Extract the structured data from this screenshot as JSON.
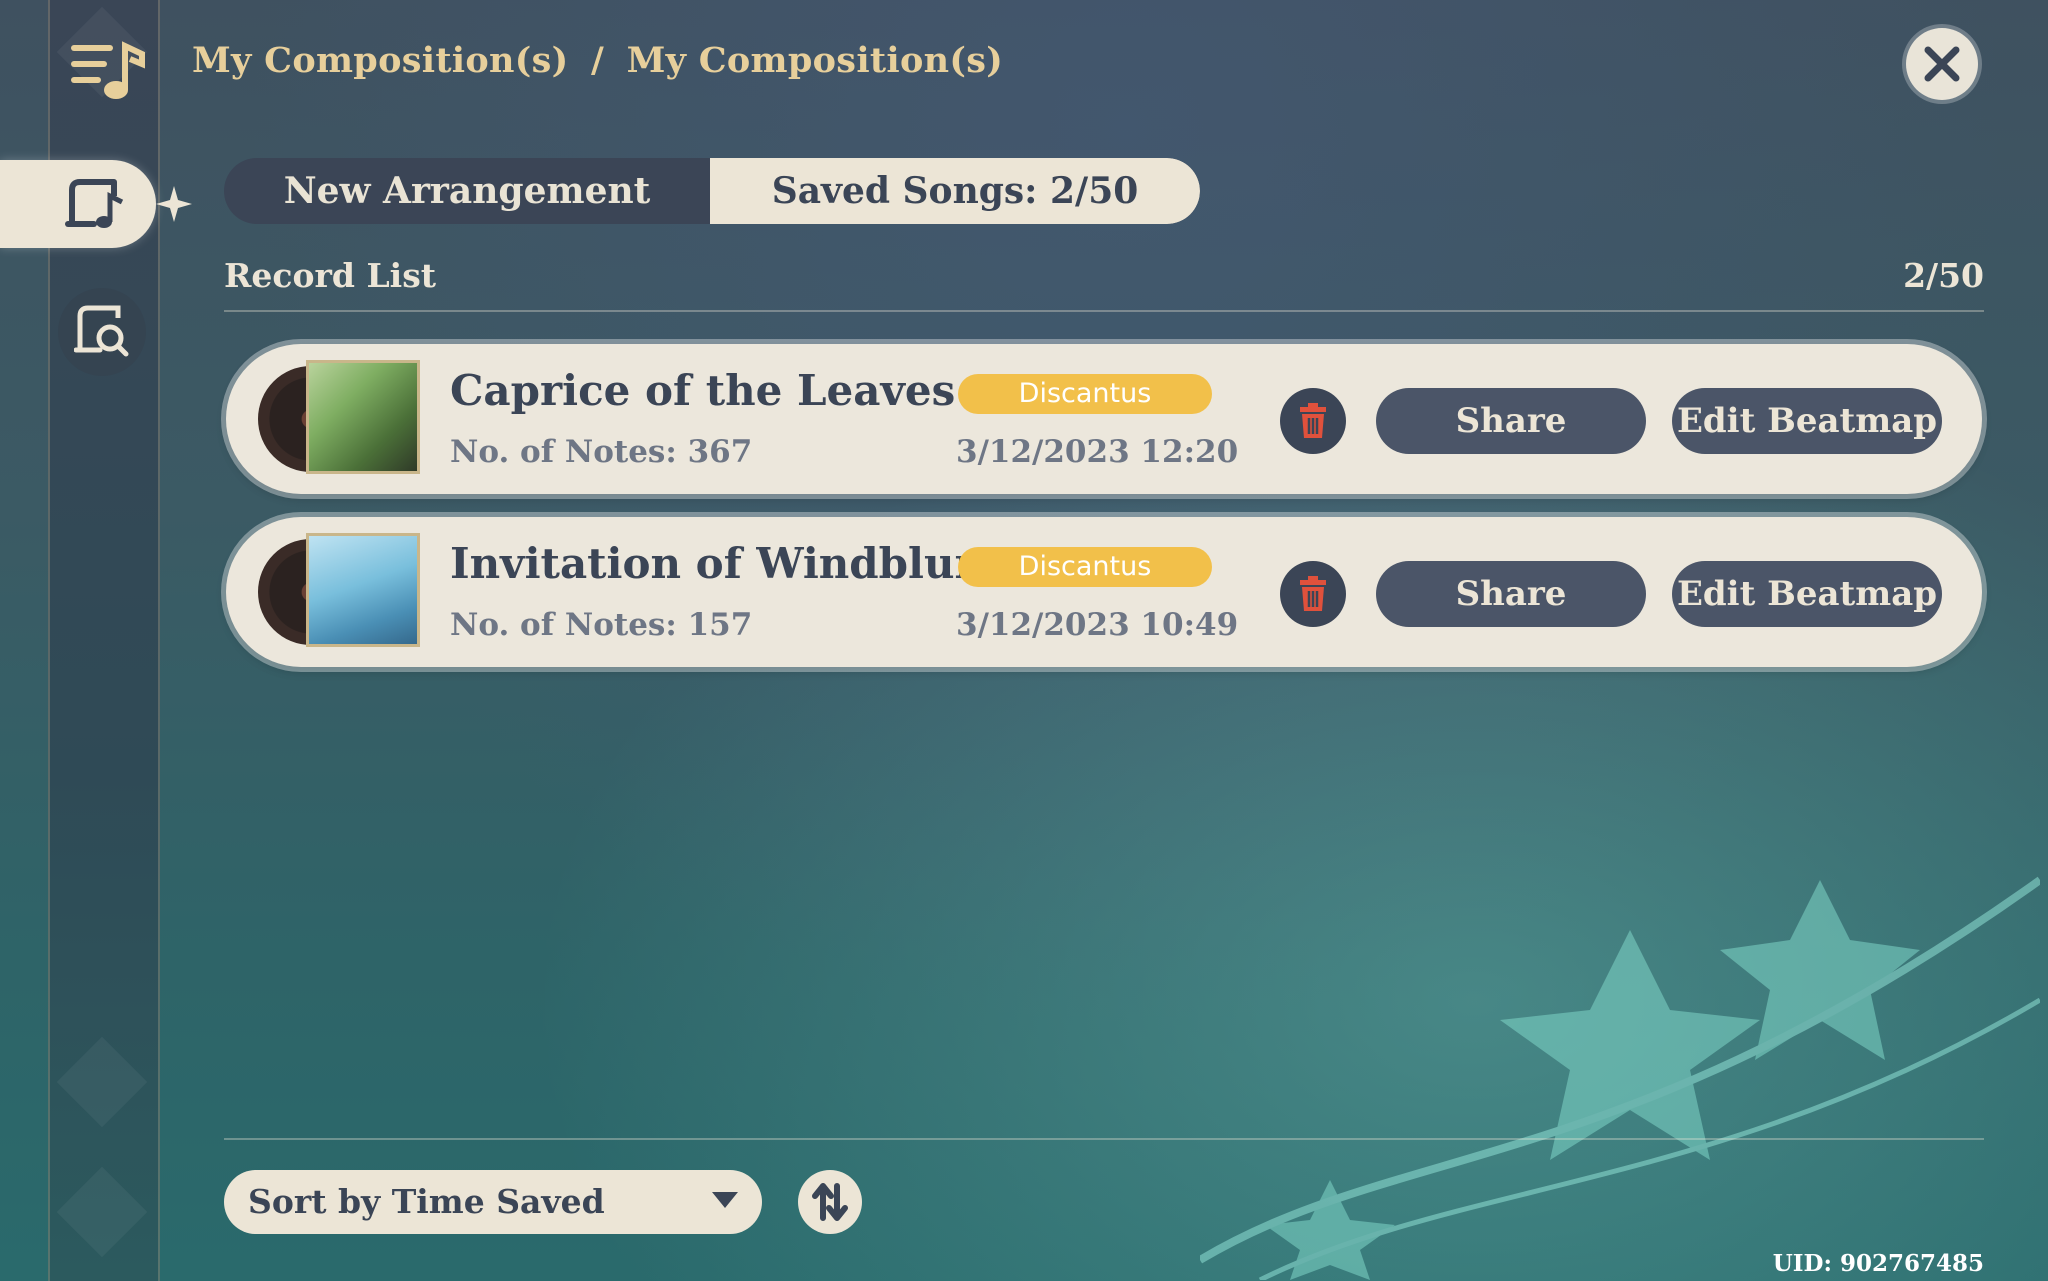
{
  "breadcrumb": {
    "part1": "My Composition(s)",
    "separator": "/",
    "part2": "My Composition(s)"
  },
  "tabs": {
    "new_arrangement": "New Arrangement",
    "saved_songs": "Saved Songs: 2/50"
  },
  "record_list": {
    "label": "Record List",
    "count": "2/50"
  },
  "songs": [
    {
      "title": "Caprice of the Leaves",
      "badge": "Discantus",
      "notes": "No. of Notes: 367",
      "time": "3/12/2023 12:20",
      "share": "Share",
      "edit": "Edit Beatmap"
    },
    {
      "title": "Invitation of Windblume",
      "badge": "Discantus",
      "notes": "No. of Notes: 157",
      "time": "3/12/2023 10:49",
      "share": "Share",
      "edit": "Edit Beatmap"
    }
  ],
  "sort": {
    "label": "Sort by Time Saved"
  },
  "uid": "UID: 902767485",
  "icons": {
    "menu": "music-menu-icon",
    "compose": "music-score-icon",
    "search": "score-search-icon",
    "close": "close-icon",
    "delete": "trash-icon",
    "dropdown": "caret-down-icon",
    "order": "sort-order-icon"
  },
  "colors": {
    "accent_gold": "#e7cf9b",
    "badge": "#f2c04a",
    "delete_red": "#e0513c",
    "dark_button": "#4b5568"
  }
}
